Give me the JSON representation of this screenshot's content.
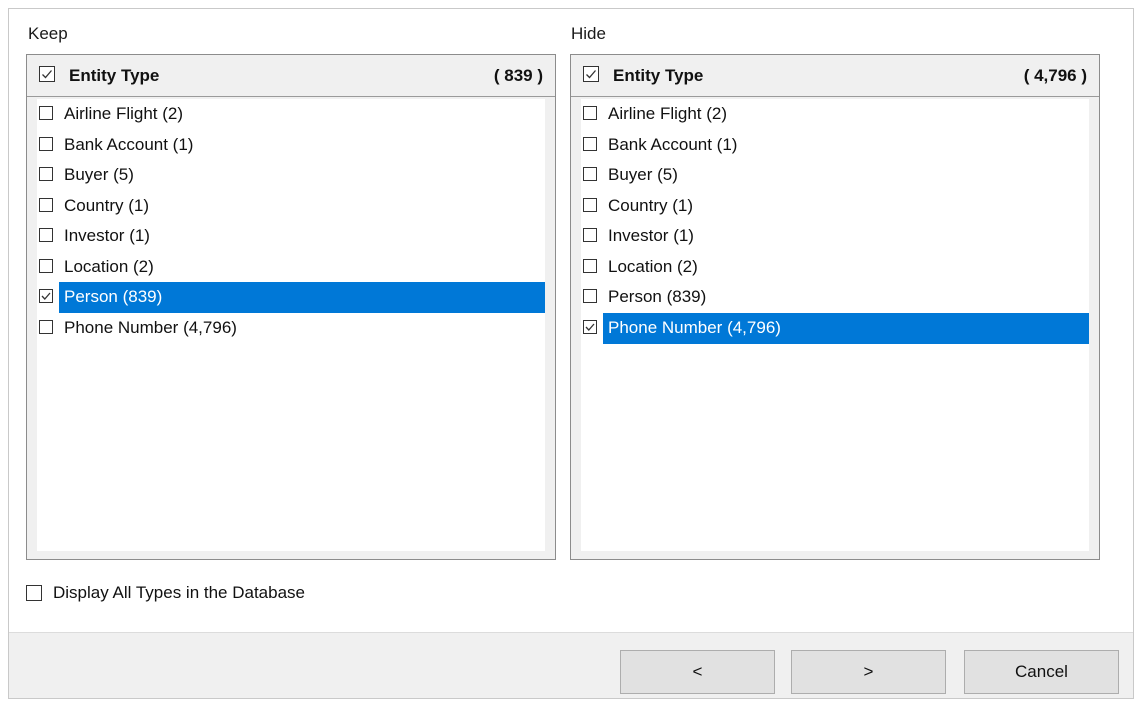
{
  "keep": {
    "label": "Keep",
    "header": {
      "title": "Entity Type",
      "count": "( 839 )"
    },
    "items": [
      {
        "label": "Airline Flight (2)",
        "checked": false,
        "selected": false
      },
      {
        "label": "Bank Account (1)",
        "checked": false,
        "selected": false
      },
      {
        "label": "Buyer (5)",
        "checked": false,
        "selected": false
      },
      {
        "label": "Country (1)",
        "checked": false,
        "selected": false
      },
      {
        "label": "Investor (1)",
        "checked": false,
        "selected": false
      },
      {
        "label": "Location (2)",
        "checked": false,
        "selected": false
      },
      {
        "label": "Person (839)",
        "checked": true,
        "selected": true
      },
      {
        "label": "Phone Number (4,796)",
        "checked": false,
        "selected": false
      }
    ]
  },
  "hide": {
    "label": "Hide",
    "header": {
      "title": "Entity Type",
      "count": "( 4,796 )"
    },
    "items": [
      {
        "label": "Airline Flight (2)",
        "checked": false,
        "selected": false
      },
      {
        "label": "Bank Account (1)",
        "checked": false,
        "selected": false
      },
      {
        "label": "Buyer (5)",
        "checked": false,
        "selected": false
      },
      {
        "label": "Country (1)",
        "checked": false,
        "selected": false
      },
      {
        "label": "Investor (1)",
        "checked": false,
        "selected": false
      },
      {
        "label": "Location (2)",
        "checked": false,
        "selected": false
      },
      {
        "label": "Person (839)",
        "checked": false,
        "selected": false
      },
      {
        "label": "Phone Number (4,796)",
        "checked": true,
        "selected": true
      }
    ]
  },
  "display_all": {
    "label": "Display All Types in the Database",
    "checked": false
  },
  "buttons": {
    "back": "<",
    "forward": ">",
    "cancel": "Cancel"
  },
  "colors": {
    "selection": "#0078d7",
    "footer": "#f0f0f0",
    "button": "#e1e1e1"
  }
}
